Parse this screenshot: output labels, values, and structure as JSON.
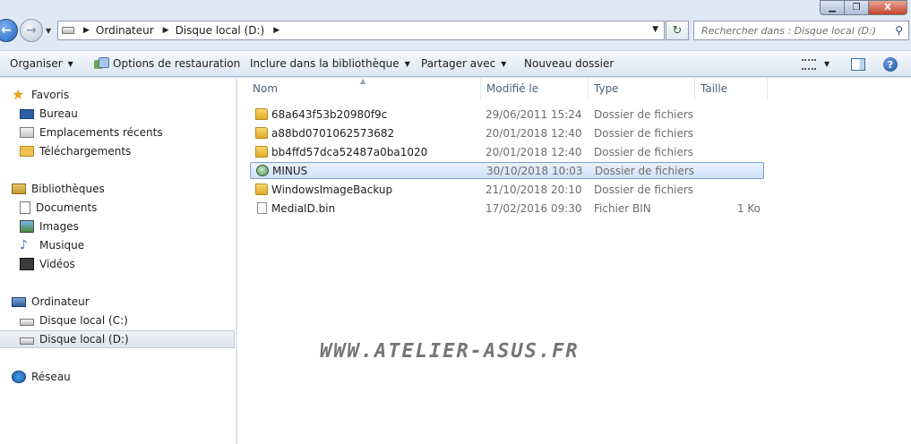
{
  "window": {
    "min_label": "▁",
    "max_label": "❐",
    "close_label": "X"
  },
  "navigation": {
    "breadcrumb": [
      "Ordinateur",
      "Disque local (D:)"
    ],
    "search_placeholder": "Rechercher dans : Disque local (D:)"
  },
  "toolbar": {
    "organize": "Organiser",
    "restore": "Options de restauration",
    "include": "Inclure dans la bibliothèque",
    "share": "Partager avec",
    "new_folder": "Nouveau dossier"
  },
  "sidebar": {
    "favorites": {
      "label": "Favoris",
      "items": [
        "Bureau",
        "Emplacements récents",
        "Téléchargements"
      ]
    },
    "libraries": {
      "label": "Bibliothèques",
      "items": [
        "Documents",
        "Images",
        "Musique",
        "Vidéos"
      ]
    },
    "computer": {
      "label": "Ordinateur",
      "items": [
        "Disque local (C:)",
        "Disque local (D:)"
      ],
      "selected": "Disque local (D:)"
    },
    "network": {
      "label": "Réseau"
    }
  },
  "columns": {
    "name": "Nom",
    "modified": "Modifié le",
    "type": "Type",
    "size": "Taille"
  },
  "files": [
    {
      "name": "68a643f53b20980f9c",
      "modified": "29/06/2011 15:24",
      "type": "Dossier de fichiers",
      "size": "",
      "icon": "folder-icon"
    },
    {
      "name": "a88bd0701062573682",
      "modified": "20/01/2018 12:40",
      "type": "Dossier de fichiers",
      "size": "",
      "icon": "folder-icon"
    },
    {
      "name": "bb4ffd57dca52487a0ba1020",
      "modified": "20/01/2018 12:40",
      "type": "Dossier de fichiers",
      "size": "",
      "icon": "folder-icon"
    },
    {
      "name": "MINUS",
      "modified": "30/10/2018 10:03",
      "type": "Dossier de fichiers",
      "size": "",
      "icon": "minus-folder-icon",
      "selected": true
    },
    {
      "name": "WindowsImageBackup",
      "modified": "21/10/2018 20:10",
      "type": "Dossier de fichiers",
      "size": "",
      "icon": "folder-icon"
    },
    {
      "name": "MediaID.bin",
      "modified": "17/02/2016 09:30",
      "type": "Fichier BIN",
      "size": "1 Ko",
      "icon": "file-icon"
    }
  ],
  "watermark": "WWW.ATELIER-ASUS.FR"
}
